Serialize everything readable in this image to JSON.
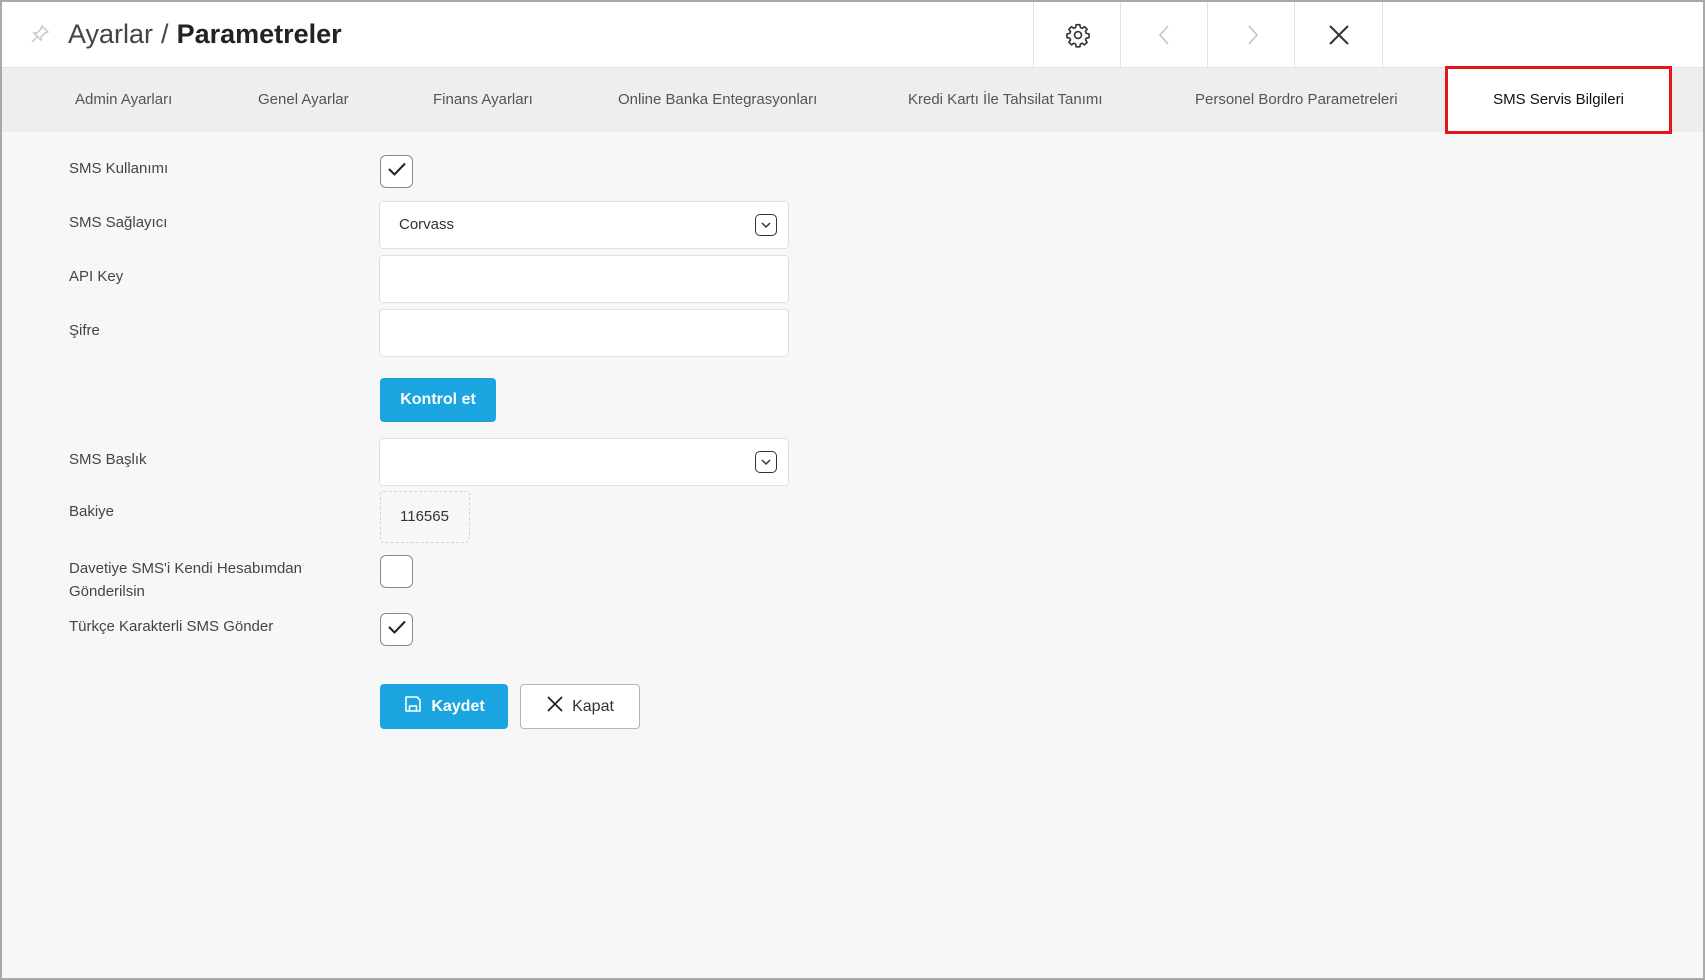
{
  "header": {
    "breadcrumb_root": "Ayarlar",
    "breadcrumb_separator": "/",
    "page_title": "Parametreler",
    "icons": [
      "pin-icon",
      "gear-icon",
      "chevron-left-icon",
      "chevron-right-icon",
      "close-icon"
    ]
  },
  "tabs": [
    {
      "label": "Admin Ayarları"
    },
    {
      "label": "Genel Ayarlar"
    },
    {
      "label": "Finans Ayarları"
    },
    {
      "label": "Online Banka Entegrasyonları"
    },
    {
      "label": "Kredi Kartı İle Tahsilat Tanımı"
    },
    {
      "label": "Personel Bordro Parametreleri"
    },
    {
      "label": "SMS Servis Bilgileri",
      "active": true
    }
  ],
  "form": {
    "sms_usage": {
      "label": "SMS Kullanımı",
      "checked": true
    },
    "sms_provider": {
      "label": "SMS Sağlayıcı",
      "value": "Corvass"
    },
    "api_key": {
      "label": "API Key",
      "value": ""
    },
    "password": {
      "label": "Şifre",
      "value": ""
    },
    "check_button": "Kontrol et",
    "sms_header": {
      "label": "SMS Başlık",
      "value": ""
    },
    "balance": {
      "label": "Bakiye",
      "value": "116565"
    },
    "invite_own_account": {
      "label_line1": "Davetiye SMS'i Kendi Hesabımdan",
      "label_line2": "Gönderilsin",
      "checked": false
    },
    "turkish_chars": {
      "label": "Türkçe Karakterli SMS Gönder",
      "checked": true
    }
  },
  "actions": {
    "save_label": "Kaydet",
    "close_label": "Kapat"
  },
  "colors": {
    "primary": "#1aa5e0",
    "active_tab_border": "#e8141b"
  }
}
